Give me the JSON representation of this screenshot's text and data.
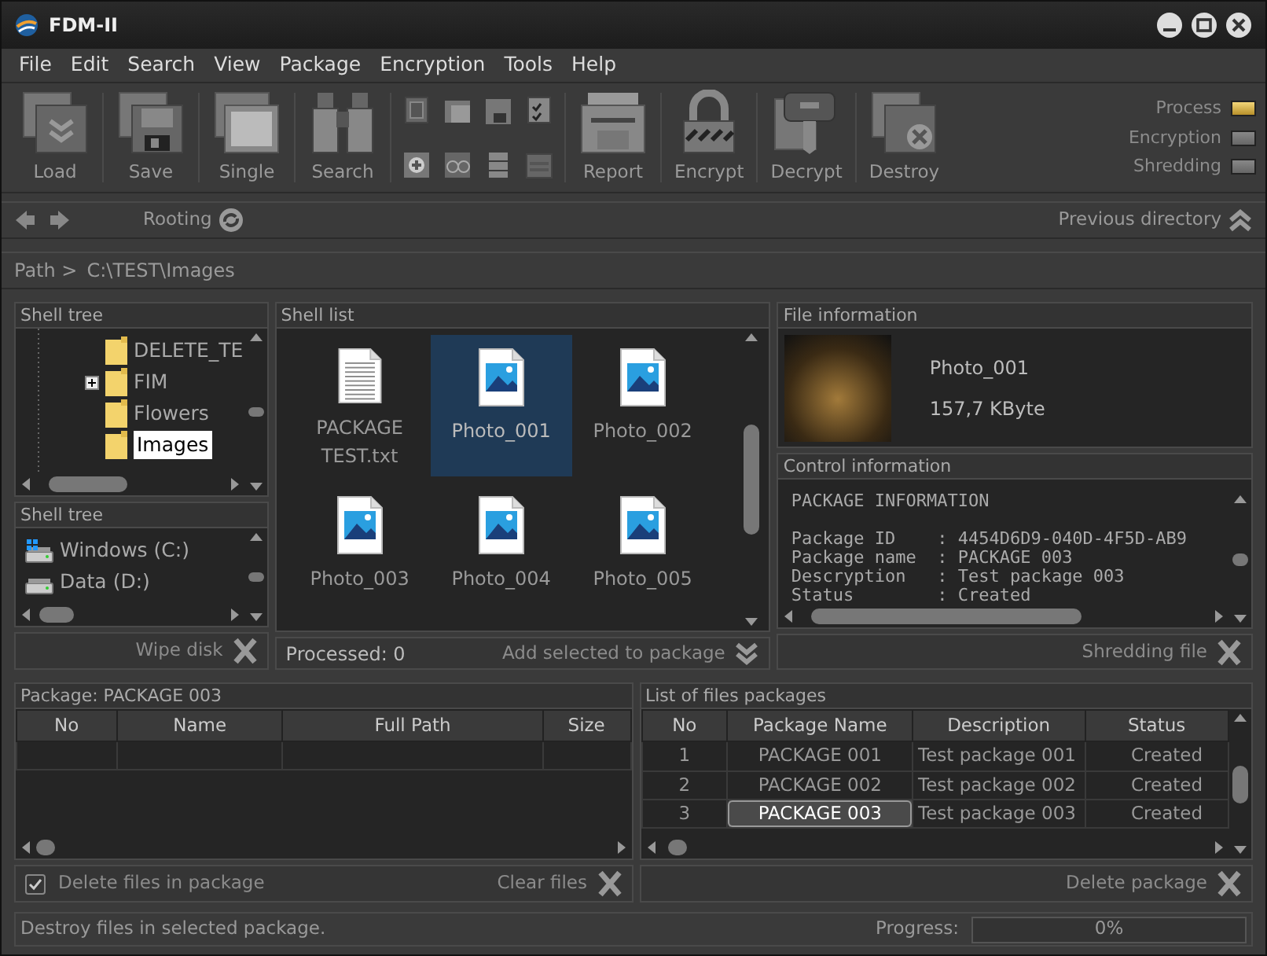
{
  "window": {
    "title": "FDM-II"
  },
  "menu": [
    "File",
    "Edit",
    "Search",
    "View",
    "Package",
    "Encryption",
    "Tools",
    "Help"
  ],
  "toolbar": [
    {
      "kind": "load",
      "label": "Load"
    },
    {
      "kind": "save",
      "label": "Save"
    },
    {
      "kind": "single",
      "label": "Single"
    },
    {
      "kind": "search",
      "label": "Search"
    },
    {
      "kind": "tools"
    },
    {
      "kind": "report",
      "label": "Report"
    },
    {
      "kind": "encrypt",
      "label": "Encrypt"
    },
    {
      "kind": "decrypt",
      "label": "Decrypt"
    },
    {
      "kind": "destroy",
      "label": "Destroy"
    }
  ],
  "indicators": [
    {
      "label": "Process",
      "on": true
    },
    {
      "label": "Encryption",
      "on": false
    },
    {
      "label": "Shredding",
      "on": false
    }
  ],
  "navigation": {
    "rooting": "Rooting",
    "previous": "Previous directory"
  },
  "path": {
    "label": "Path >",
    "value": "C:\\TEST\\Images"
  },
  "shell_tree": {
    "title": "Shell tree",
    "items": [
      {
        "label": "DELETE_TE",
        "expander": false,
        "selected": false
      },
      {
        "label": "FIM",
        "expander": true,
        "selected": false
      },
      {
        "label": "Flowers",
        "expander": false,
        "selected": false
      },
      {
        "label": "Images",
        "expander": false,
        "selected": true
      }
    ]
  },
  "drives": {
    "title": "Shell tree",
    "items": [
      {
        "label": "Windows (C:)",
        "kind": "system"
      },
      {
        "label": "Data (D:)",
        "kind": "data"
      }
    ],
    "action": "Wipe disk"
  },
  "shell_list": {
    "title": "Shell list",
    "items": [
      {
        "label": "PACKAGE TEST.txt",
        "kind": "text",
        "selected": false
      },
      {
        "label": "Photo_001",
        "kind": "image",
        "selected": true
      },
      {
        "label": "Photo_002",
        "kind": "image",
        "selected": false
      },
      {
        "label": "Photo_003",
        "kind": "image",
        "selected": false
      },
      {
        "label": "Photo_004",
        "kind": "image",
        "selected": false
      },
      {
        "label": "Photo_005",
        "kind": "image",
        "selected": false
      }
    ],
    "processed": "Processed: 0",
    "action": "Add selected to package"
  },
  "file_info": {
    "title": "File information",
    "name": "Photo_001",
    "size": "157,7 KByte"
  },
  "control_info": {
    "title": "Control information",
    "heading": "PACKAGE INFORMATION",
    "separator": ":",
    "fields": [
      {
        "key": "Package ID",
        "value": "4454D6D9-040D-4F5D-AB9"
      },
      {
        "key": "Package name",
        "value": "PACKAGE 003"
      },
      {
        "key": "Descryption",
        "value": "Test package 003"
      },
      {
        "key": "Status",
        "value": "Created"
      }
    ],
    "action": "Shredding file"
  },
  "package": {
    "title": "Package: PACKAGE 003",
    "columns": [
      "No",
      "Name",
      "Full Path",
      "Size"
    ],
    "delete_files": {
      "label": "Delete files in package",
      "checked": true
    },
    "action": "Clear files"
  },
  "packages": {
    "title": "List of files packages",
    "columns": [
      "No",
      "Package Name",
      "Description",
      "Status"
    ],
    "rows": [
      {
        "cells": [
          "1",
          "PACKAGE 001",
          "Test package 001",
          "Created"
        ],
        "selected": false
      },
      {
        "cells": [
          "2",
          "PACKAGE 002",
          "Test package 002",
          "Created"
        ],
        "selected": false
      },
      {
        "cells": [
          "3",
          "PACKAGE 003",
          "Test package 003",
          "Created"
        ],
        "selected": true
      }
    ],
    "action": "Delete package"
  },
  "status_bar": {
    "message": "Destroy files in selected package.",
    "progress_label": "Progress:",
    "progress_text": "0%",
    "level": 0
  }
}
